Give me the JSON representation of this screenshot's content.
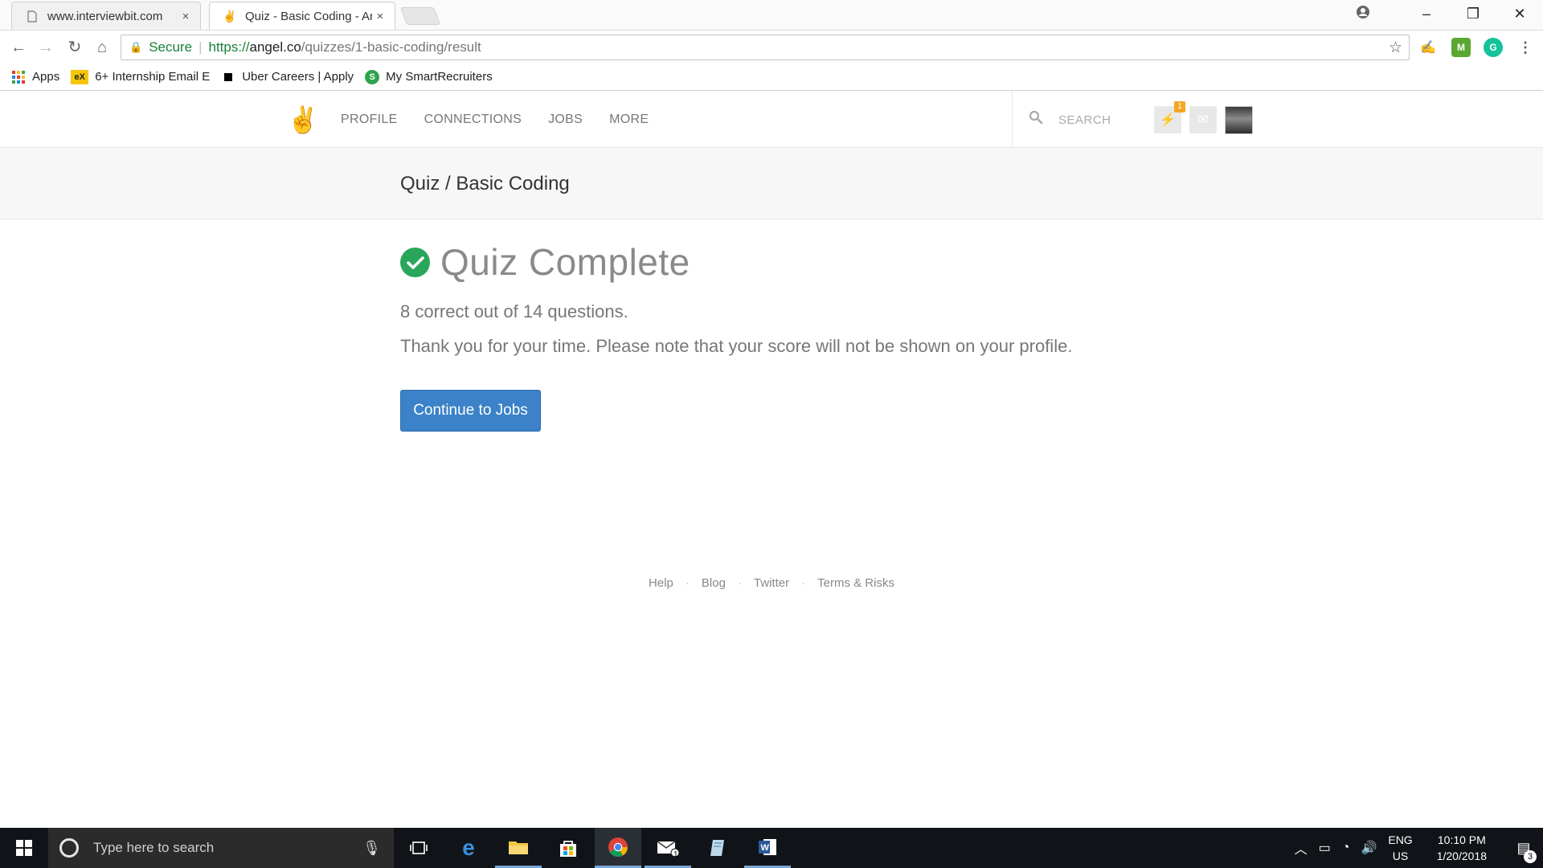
{
  "browser": {
    "tabs": [
      {
        "title": "www.interviewbit.com",
        "close": "×",
        "active": false,
        "icon": "page-icon"
      },
      {
        "title": "Quiz - Basic Coding - An",
        "close": "×",
        "active": true,
        "icon": "angellist-icon"
      }
    ],
    "omnibox": {
      "secure_label": "Secure",
      "url_scheme": "https://",
      "url_host": "angel.co",
      "url_path": "/quizzes/1-basic-coding/result"
    },
    "bookmarks": [
      {
        "label": "Apps",
        "icon": "apps-grid-icon"
      },
      {
        "label": "6+ Internship Email E",
        "icon": "ex-icon"
      },
      {
        "label": "Uber Careers | Apply",
        "icon": "uber-icon"
      },
      {
        "label": "My SmartRecruiters",
        "icon": "smartrecruiters-icon"
      }
    ]
  },
  "site": {
    "nav": [
      "PROFILE",
      "CONNECTIONS",
      "JOBS",
      "MORE"
    ],
    "search_placeholder": "SEARCH",
    "notification_count": "1",
    "breadcrumb": "Quiz / Basic Coding",
    "headline": "Quiz Complete",
    "score_text": "8 correct out of 14 questions.",
    "note_text": "Thank you for your time. Please note that your score will not be shown on your profile.",
    "cta_label": "Continue to Jobs",
    "footer_links": [
      "Help",
      "Blog",
      "Twitter",
      "Terms & Risks"
    ],
    "colors": {
      "accent": "#3b82c8",
      "success": "#2aa65a",
      "badge": "#f5a623"
    }
  },
  "taskbar": {
    "search_placeholder": "Type here to search",
    "lang_line1": "ENG",
    "lang_line2": "US",
    "time": "10:10 PM",
    "date": "1/20/2018",
    "mail_badge": "1",
    "notification_badge": "3"
  }
}
